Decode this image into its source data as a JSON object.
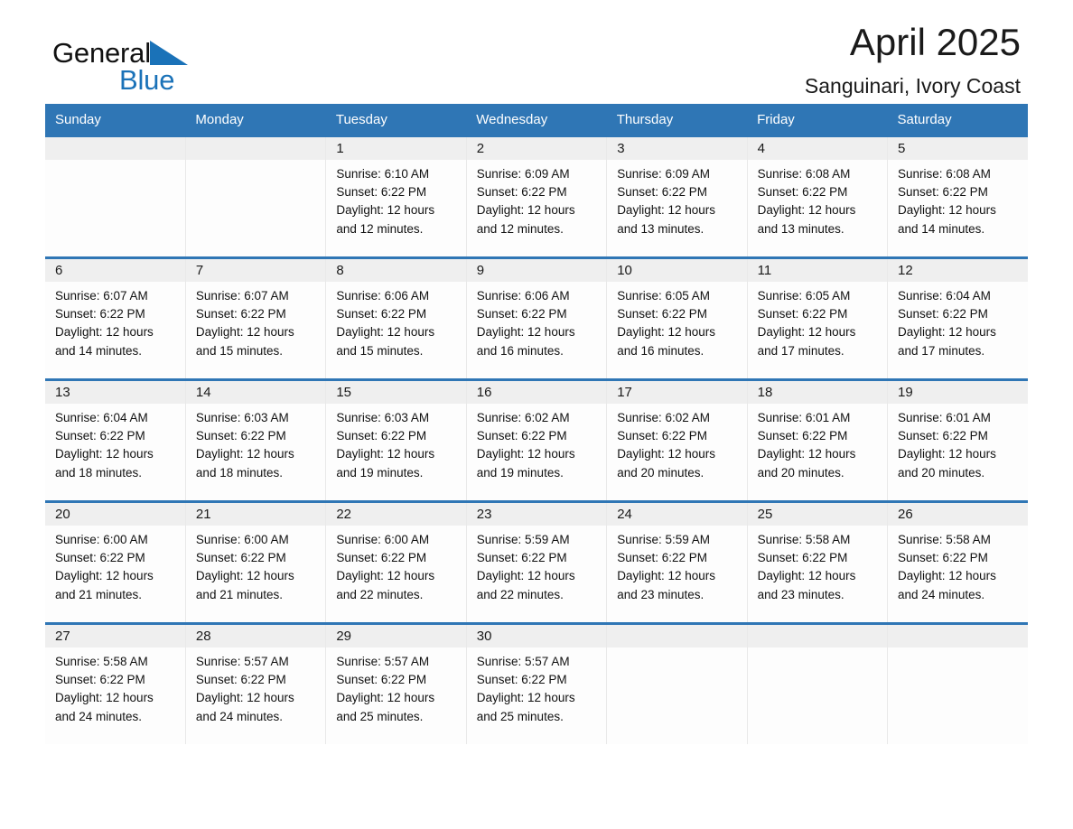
{
  "brand": {
    "word_general": "General",
    "word_blue": "Blue",
    "logo_icon": "triangle-logo-icon",
    "accent_color": "#1a72b8"
  },
  "header": {
    "month_title": "April 2025",
    "location": "Sanguinari, Ivory Coast",
    "header_bg_color": "#2f76b5",
    "daynum_strip_color": "#efefef"
  },
  "weekday_headers": [
    "Sunday",
    "Monday",
    "Tuesday",
    "Wednesday",
    "Thursday",
    "Friday",
    "Saturday"
  ],
  "weeks": [
    [
      {
        "day": "",
        "lines": []
      },
      {
        "day": "",
        "lines": []
      },
      {
        "day": "1",
        "lines": [
          "Sunrise: 6:10 AM",
          "Sunset: 6:22 PM",
          "Daylight: 12 hours",
          "and 12 minutes."
        ]
      },
      {
        "day": "2",
        "lines": [
          "Sunrise: 6:09 AM",
          "Sunset: 6:22 PM",
          "Daylight: 12 hours",
          "and 12 minutes."
        ]
      },
      {
        "day": "3",
        "lines": [
          "Sunrise: 6:09 AM",
          "Sunset: 6:22 PM",
          "Daylight: 12 hours",
          "and 13 minutes."
        ]
      },
      {
        "day": "4",
        "lines": [
          "Sunrise: 6:08 AM",
          "Sunset: 6:22 PM",
          "Daylight: 12 hours",
          "and 13 minutes."
        ]
      },
      {
        "day": "5",
        "lines": [
          "Sunrise: 6:08 AM",
          "Sunset: 6:22 PM",
          "Daylight: 12 hours",
          "and 14 minutes."
        ]
      }
    ],
    [
      {
        "day": "6",
        "lines": [
          "Sunrise: 6:07 AM",
          "Sunset: 6:22 PM",
          "Daylight: 12 hours",
          "and 14 minutes."
        ]
      },
      {
        "day": "7",
        "lines": [
          "Sunrise: 6:07 AM",
          "Sunset: 6:22 PM",
          "Daylight: 12 hours",
          "and 15 minutes."
        ]
      },
      {
        "day": "8",
        "lines": [
          "Sunrise: 6:06 AM",
          "Sunset: 6:22 PM",
          "Daylight: 12 hours",
          "and 15 minutes."
        ]
      },
      {
        "day": "9",
        "lines": [
          "Sunrise: 6:06 AM",
          "Sunset: 6:22 PM",
          "Daylight: 12 hours",
          "and 16 minutes."
        ]
      },
      {
        "day": "10",
        "lines": [
          "Sunrise: 6:05 AM",
          "Sunset: 6:22 PM",
          "Daylight: 12 hours",
          "and 16 minutes."
        ]
      },
      {
        "day": "11",
        "lines": [
          "Sunrise: 6:05 AM",
          "Sunset: 6:22 PM",
          "Daylight: 12 hours",
          "and 17 minutes."
        ]
      },
      {
        "day": "12",
        "lines": [
          "Sunrise: 6:04 AM",
          "Sunset: 6:22 PM",
          "Daylight: 12 hours",
          "and 17 minutes."
        ]
      }
    ],
    [
      {
        "day": "13",
        "lines": [
          "Sunrise: 6:04 AM",
          "Sunset: 6:22 PM",
          "Daylight: 12 hours",
          "and 18 minutes."
        ]
      },
      {
        "day": "14",
        "lines": [
          "Sunrise: 6:03 AM",
          "Sunset: 6:22 PM",
          "Daylight: 12 hours",
          "and 18 minutes."
        ]
      },
      {
        "day": "15",
        "lines": [
          "Sunrise: 6:03 AM",
          "Sunset: 6:22 PM",
          "Daylight: 12 hours",
          "and 19 minutes."
        ]
      },
      {
        "day": "16",
        "lines": [
          "Sunrise: 6:02 AM",
          "Sunset: 6:22 PM",
          "Daylight: 12 hours",
          "and 19 minutes."
        ]
      },
      {
        "day": "17",
        "lines": [
          "Sunrise: 6:02 AM",
          "Sunset: 6:22 PM",
          "Daylight: 12 hours",
          "and 20 minutes."
        ]
      },
      {
        "day": "18",
        "lines": [
          "Sunrise: 6:01 AM",
          "Sunset: 6:22 PM",
          "Daylight: 12 hours",
          "and 20 minutes."
        ]
      },
      {
        "day": "19",
        "lines": [
          "Sunrise: 6:01 AM",
          "Sunset: 6:22 PM",
          "Daylight: 12 hours",
          "and 20 minutes."
        ]
      }
    ],
    [
      {
        "day": "20",
        "lines": [
          "Sunrise: 6:00 AM",
          "Sunset: 6:22 PM",
          "Daylight: 12 hours",
          "and 21 minutes."
        ]
      },
      {
        "day": "21",
        "lines": [
          "Sunrise: 6:00 AM",
          "Sunset: 6:22 PM",
          "Daylight: 12 hours",
          "and 21 minutes."
        ]
      },
      {
        "day": "22",
        "lines": [
          "Sunrise: 6:00 AM",
          "Sunset: 6:22 PM",
          "Daylight: 12 hours",
          "and 22 minutes."
        ]
      },
      {
        "day": "23",
        "lines": [
          "Sunrise: 5:59 AM",
          "Sunset: 6:22 PM",
          "Daylight: 12 hours",
          "and 22 minutes."
        ]
      },
      {
        "day": "24",
        "lines": [
          "Sunrise: 5:59 AM",
          "Sunset: 6:22 PM",
          "Daylight: 12 hours",
          "and 23 minutes."
        ]
      },
      {
        "day": "25",
        "lines": [
          "Sunrise: 5:58 AM",
          "Sunset: 6:22 PM",
          "Daylight: 12 hours",
          "and 23 minutes."
        ]
      },
      {
        "day": "26",
        "lines": [
          "Sunrise: 5:58 AM",
          "Sunset: 6:22 PM",
          "Daylight: 12 hours",
          "and 24 minutes."
        ]
      }
    ],
    [
      {
        "day": "27",
        "lines": [
          "Sunrise: 5:58 AM",
          "Sunset: 6:22 PM",
          "Daylight: 12 hours",
          "and 24 minutes."
        ]
      },
      {
        "day": "28",
        "lines": [
          "Sunrise: 5:57 AM",
          "Sunset: 6:22 PM",
          "Daylight: 12 hours",
          "and 24 minutes."
        ]
      },
      {
        "day": "29",
        "lines": [
          "Sunrise: 5:57 AM",
          "Sunset: 6:22 PM",
          "Daylight: 12 hours",
          "and 25 minutes."
        ]
      },
      {
        "day": "30",
        "lines": [
          "Sunrise: 5:57 AM",
          "Sunset: 6:22 PM",
          "Daylight: 12 hours",
          "and 25 minutes."
        ]
      },
      {
        "day": "",
        "lines": []
      },
      {
        "day": "",
        "lines": []
      },
      {
        "day": "",
        "lines": []
      }
    ]
  ]
}
